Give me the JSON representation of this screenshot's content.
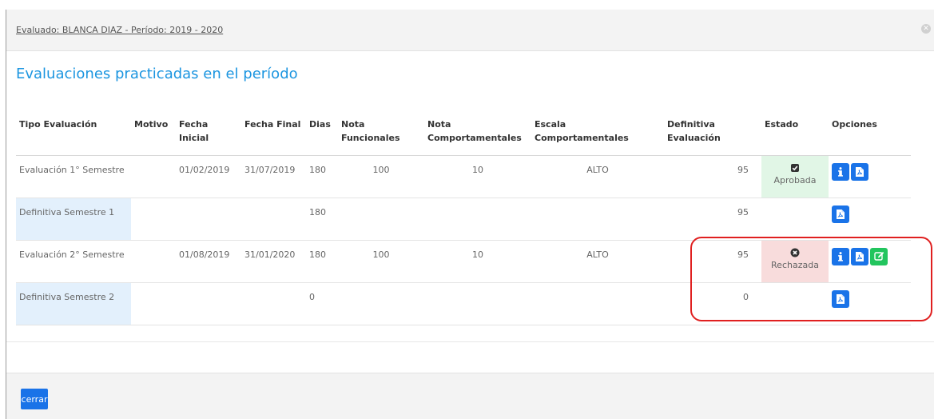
{
  "header": {
    "title": "Evaluado: BLANCA DIAZ - Período: 2019 - 2020"
  },
  "section_title": "Evaluaciones practicadas en el período",
  "table": {
    "columns": {
      "tipo": "Tipo Evaluación",
      "motivo": "Motivo",
      "fecha_inicial": "Fecha Inicial",
      "fecha_final": "Fecha Final",
      "dias": "Dias",
      "nota_funcionales": "Nota Funcionales",
      "nota_comportamentales": "Nota Comportamentales",
      "escala": "Escala Comportamentales",
      "definitiva": "Definitiva Evaluación",
      "estado": "Estado",
      "opciones": "Opciones"
    },
    "rows": [
      {
        "tipo": "Evaluación 1° Semestre",
        "motivo": "",
        "fecha_inicial": "01/02/2019",
        "fecha_final": "31/07/2019",
        "dias": "180",
        "nota_funcionales": "100",
        "nota_comportamentales": "10",
        "escala": "ALTO",
        "definitiva": "95",
        "estado": "Aprobada"
      },
      {
        "tipo": "Definitiva Semestre 1",
        "motivo": "",
        "fecha_inicial": "",
        "fecha_final": "",
        "dias": "180",
        "nota_funcionales": "",
        "nota_comportamentales": "",
        "escala": "",
        "definitiva": "95",
        "estado": ""
      },
      {
        "tipo": "Evaluación 2° Semestre",
        "motivo": "",
        "fecha_inicial": "01/08/2019",
        "fecha_final": "31/01/2020",
        "dias": "180",
        "nota_funcionales": "100",
        "nota_comportamentales": "10",
        "escala": "ALTO",
        "definitiva": "95",
        "estado": "Rechazada"
      },
      {
        "tipo": "Definitiva Semestre 2",
        "motivo": "",
        "fecha_inicial": "",
        "fecha_final": "",
        "dias": "0",
        "nota_funcionales": "",
        "nota_comportamentales": "",
        "escala": "",
        "definitiva": "0",
        "estado": ""
      }
    ]
  },
  "footer": {
    "close_label": "cerrar"
  },
  "colors": {
    "accent": "#1a73e8",
    "title": "#1b95e0",
    "approved_bg": "#e1f6e6",
    "rejected_bg": "#f8dcdc",
    "edit": "#22c55e",
    "highlight": "#e02020"
  },
  "icons": {
    "info": "info-icon",
    "pdf": "pdf-icon",
    "edit": "edit-icon",
    "approved": "check-square-icon",
    "rejected": "x-circle-icon",
    "close": "close-icon"
  }
}
